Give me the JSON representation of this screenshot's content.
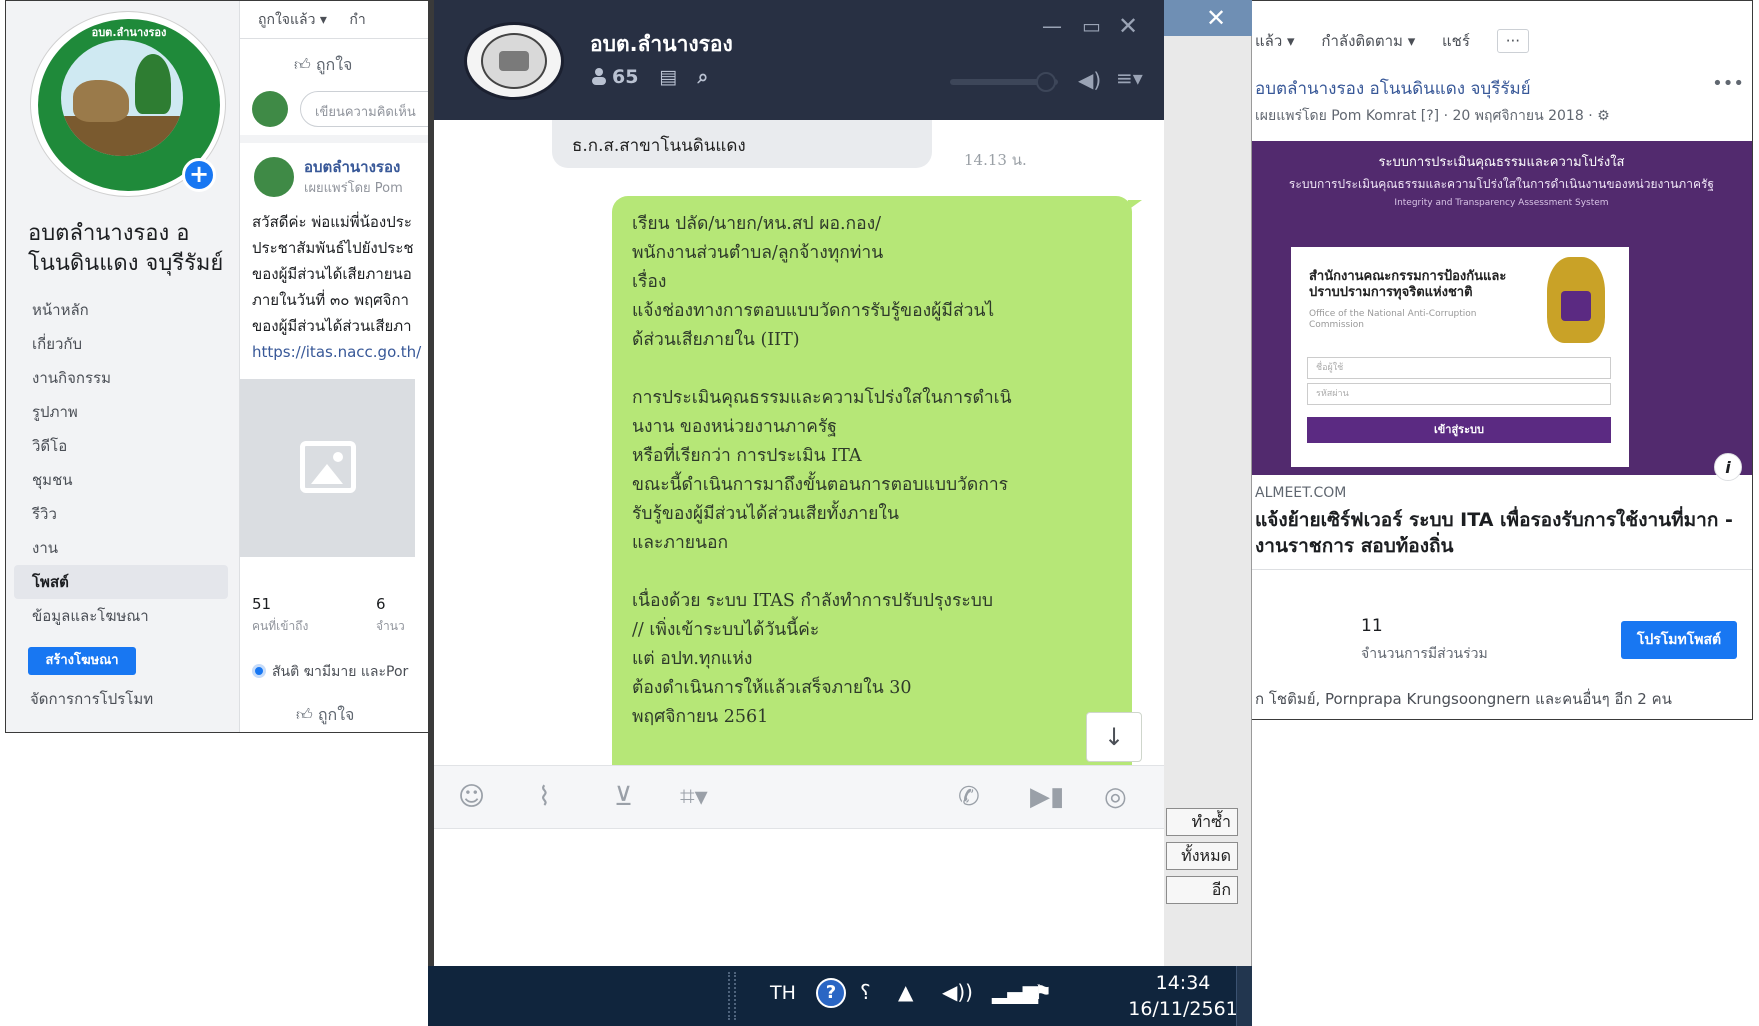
{
  "left_page": {
    "logo_text": "อบต.ลำนางรอง",
    "page_name": "อบตลำนางรอง อ โนนดินแดง จบุรีรัมย์",
    "nav": [
      "หน้าหลัก",
      "เกี่ยวกับ",
      "งานกิจกรรม",
      "รูปภาพ",
      "วิดีโอ",
      "ชุมชน",
      "รีวิว",
      "งาน",
      "โพสต์",
      "ข้อมูลและโฆษณา"
    ],
    "promote_label": "สร้างโฆษณา",
    "manage_label": "จัดการการโปรโมท"
  },
  "left_feed": {
    "liked_label": "ถูกใจแล้ว ▾",
    "follow_label": "กำ",
    "like_label": "ถูกใจ",
    "composer_placeholder": "เขียนความคิดเห็น",
    "post_author": "อบตลำนางรอง",
    "post_sub": "เผยแพร่โดย Pom",
    "post_lines": [
      "สวัสดีค่ะ พ่อแม่พี่น้องประ",
      "ประชาสัมพันธ์ไปยังประช",
      "ของผู้มีส่วนได้เสียภายนอ",
      "ภายในวันที่ ๓๐ พฤศจิกา",
      "ของผู้มีส่วนได้ส่วนเสียภา"
    ],
    "post_link": "https://itas.nacc.go.th/",
    "stat1_num": "51",
    "stat1_label": "คนที่เข้าถึง",
    "stat2_num": "6",
    "stat2_label": "จำนว",
    "friends_text": "สันติ ฆามีมาย และPor",
    "like_bottom": "ถูกใจ"
  },
  "chat": {
    "name": "อบต.ลำนางรอง",
    "member_count": "65",
    "prev_message": "ธ.ก.ส.สาขาโนนดินแดง",
    "prev_time": "14.13 น.",
    "message_lines": [
      "เรียน ปลัด/นายก/หน.สป ผอ.กอง/",
      "พนักงานส่วนตำบล/ลูกจ้างทุกท่าน",
      "เรื่อง",
      "แจ้งช่องทางการตอบแบบวัดการรับรู้ของผู้มีส่วนไ",
      "ด้ส่วนเสียภายใน (IIT)",
      "",
      "การประเมินคุณธรรมและความโปร่งใสในการดำเนิ",
      "นงาน ของหน่วยงานภาครัฐ",
      "หรือที่เรียกว่า การประเมิน ITA",
      "ขณะนี้ดำเนินการมาถึงขั้นตอนการตอบแบบวัดการ",
      "รับรู้ของผู้มีส่วนได้ส่วนเสียทั้งภายใน",
      "และภายนอก",
      "",
      "เนื่องด้วย ระบบ ITAS กำลังทำการปรับปรุงระบบ",
      "// เพิ่งเข้าระบบได้วันนี้ค่ะ",
      "แต่ อปท.ทุกแห่ง",
      "ต้องดำเนินการให้แล้วเสร็จภายใน 30",
      "พฤศจิกายน 2561"
    ]
  },
  "background_window": {
    "btn1": "ทำซ้ำ",
    "btn2": "ทั้งหมด",
    "btn3": "อีก"
  },
  "right_post": {
    "top_actions": [
      "แล้ว ▾",
      "กำลังติดตาม ▾",
      "แชร์",
      "···"
    ],
    "title": "อบตลำนางรอง อโนนดินแดง จบุรีรัมย์",
    "meta": "เผยแพร่โดย Pom Komrat [?] · 20 พฤศจิกายน 2018 · ⚙",
    "banner_title": "ระบบการประเมินคุณธรรมและความโปร่งใส",
    "banner_sub": "ระบบการประเมินคุณธรรมและความโปร่งใสในการดำเนินงานของหน่วยงานภาครัฐ",
    "banner_sub2": "Integrity and Transparency Assessment System",
    "card_org": "สำนักงานคณะกรรมการป้องกันและ ปราบปรามการทุจริตแห่งชาติ",
    "card_org_en": "Office of the National Anti-Corruption Commission",
    "card_field1": "ชื่อผู้ใช้",
    "card_field2": "รหัสผ่าน",
    "card_btn": "เข้าสู่ระบบ",
    "domain": "ALMEET.COM",
    "headline": "แจ้งย้ายเซิร์ฟเวอร์ ระบบ ITA เพื่อรองรับการใช้งานที่มาก - งานราชการ สอบท้องถิ่น",
    "count": "11",
    "count_label": "จำนวนการมีส่วนร่วม",
    "promote_label": "โปรโมทโพสต์",
    "friends": "ก โชติมย์, Pornprapa Krungsoongnern และคนอื่นๆ อีก 2 คน"
  },
  "taskbar": {
    "lang": "TH",
    "time": "14:34",
    "date": "16/11/2561"
  },
  "colors": {
    "chat_header": "#283043",
    "chat_bubble": "#b6e777",
    "taskbar": "#10253d",
    "facebook_blue": "#1877f2",
    "banner_purple": "#522a6e"
  }
}
